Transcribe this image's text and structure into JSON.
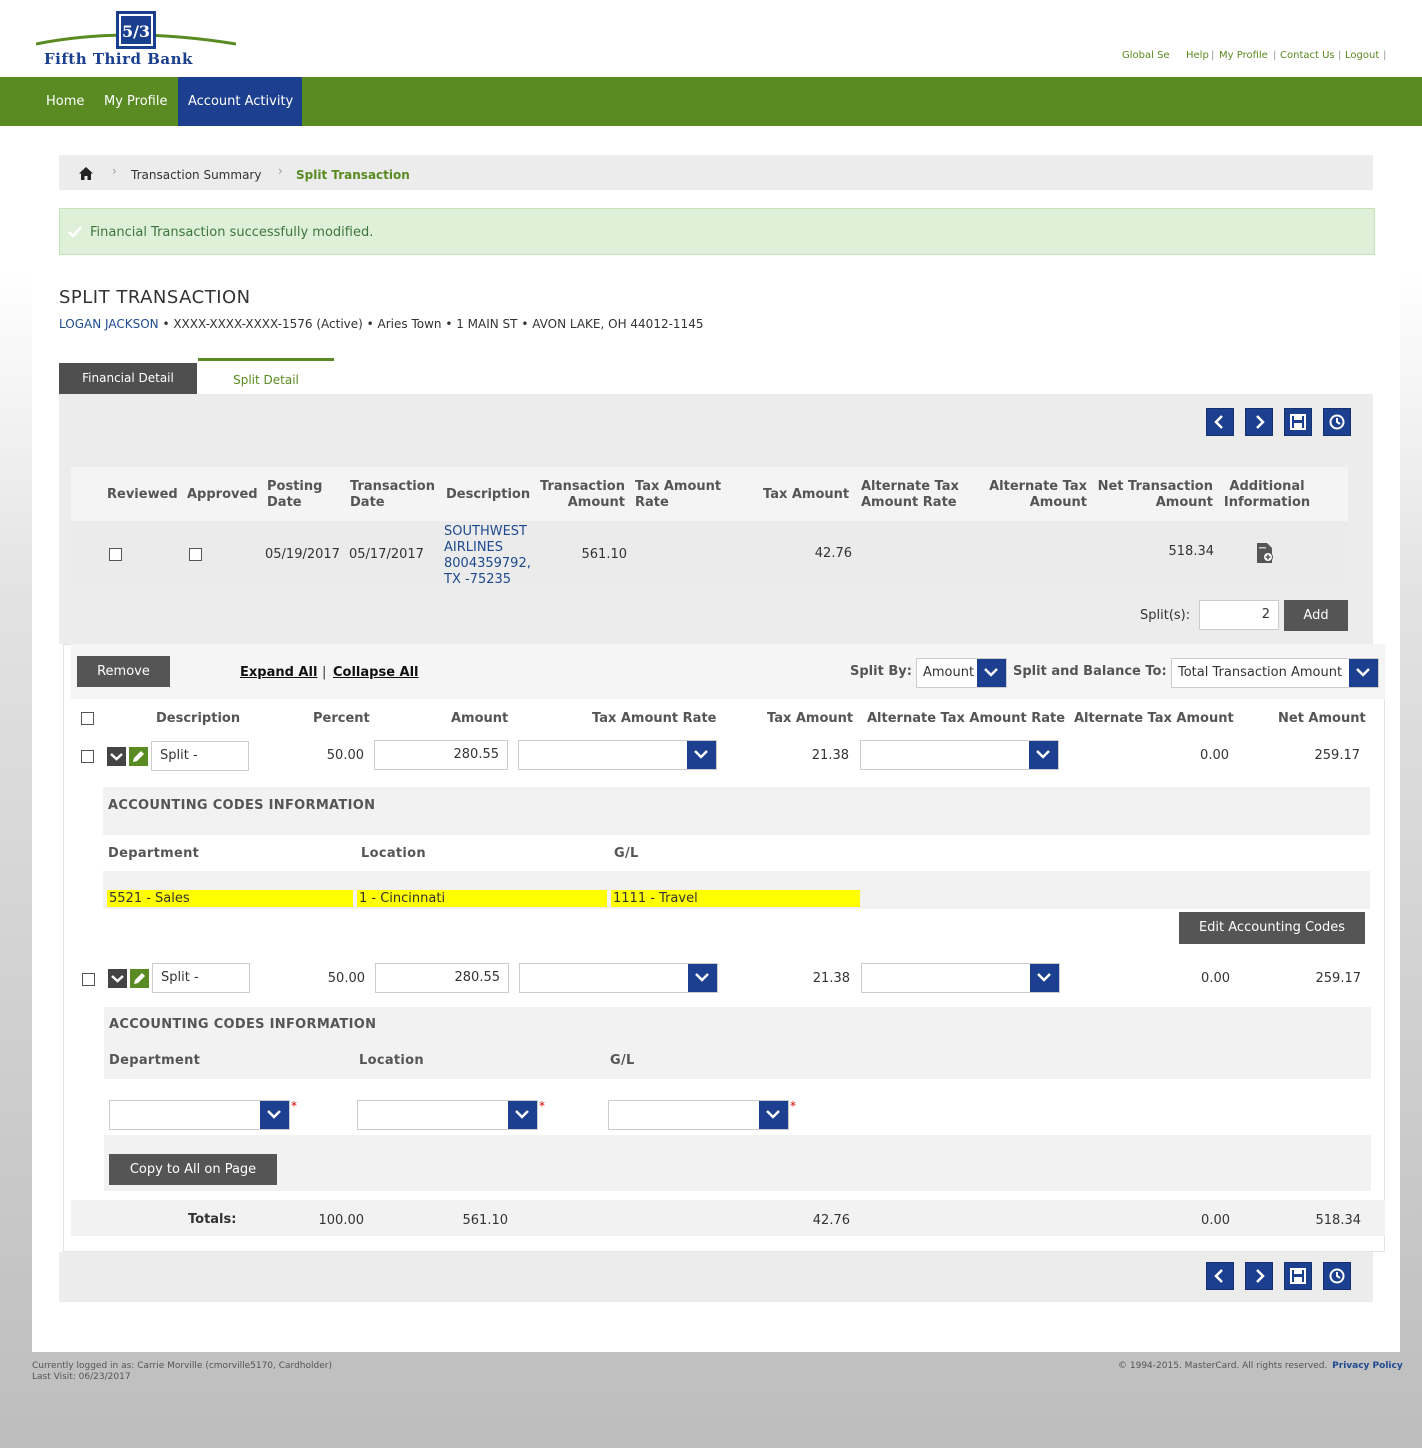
{
  "header": {
    "brand": "Fifth Third Bank",
    "links": [
      "Global Se",
      "Help",
      "My Profile",
      "Contact Us",
      "Logout"
    ],
    "nav": [
      "Home",
      "My Profile",
      "Account Activity"
    ]
  },
  "breadcrumb": [
    "Transaction Summary",
    "Split Transaction"
  ],
  "alert": "Financial Transaction successfully modified.",
  "page": {
    "title": "SPLIT TRANSACTION",
    "account_name": "LOGAN JACKSON",
    "account_info": " • XXXX-XXXX-XXXX-1576 (Active) • Aries Town • 1 MAIN ST • AVON LAKE, OH 44012-1145"
  },
  "tabs": [
    "Financial Detail",
    "Split Detail"
  ],
  "transaction": {
    "headers": {
      "reviewed": "Reviewed",
      "approved": "Approved",
      "posting_date": "Posting\nDate",
      "transaction_date": "Transaction\nDate",
      "description": "Description",
      "transaction_amount": "Transaction\nAmount",
      "tax_rate": "Tax Amount\nRate",
      "tax_amount": "Tax Amount",
      "alt_tax_rate": "Alternate Tax\nAmount Rate",
      "alt_tax_amount": "Alternate Tax\nAmount",
      "net_amount": "Net Transaction\nAmount",
      "additional_info": "Additional\nInformation"
    },
    "row": {
      "posting_date": "05/19/2017",
      "transaction_date": "05/17/2017",
      "description": "SOUTHWEST\nAIRLINES\n8004359792,\nTX -75235",
      "transaction_amount": "561.10",
      "tax_amount": "42.76",
      "net_amount": "518.34"
    }
  },
  "splits_control": {
    "label": "Split(s):",
    "value": "2",
    "add_label": "Add"
  },
  "split_toolbar": {
    "remove_label": "Remove",
    "expand_all": "Expand All",
    "separator": "|",
    "collapse_all": "Collapse All",
    "split_by_label": "Split By:",
    "split_by_value": "Amount",
    "balance_label": "Split and Balance To:",
    "balance_value": "Total Transaction Amount"
  },
  "split_headers": {
    "description": "Description",
    "percent": "Percent",
    "amount": "Amount",
    "tax_rate": "Tax Amount Rate",
    "tax_amount": "Tax Amount",
    "alt_tax_rate": "Alternate Tax Amount Rate",
    "alt_tax_amount": "Alternate Tax Amount",
    "net_amount": "Net Amount"
  },
  "splits": [
    {
      "description": "Split -",
      "percent": "50.00",
      "amount": "280.55",
      "tax_amount": "21.38",
      "alt_tax_amount": "0.00",
      "net_amount": "259.17",
      "acct_title": "ACCOUNTING CODES INFORMATION",
      "department_label": "Department",
      "location_label": "Location",
      "gl_label": "G/L",
      "department": "5521 - Sales",
      "location": "1 - Cincinnati",
      "gl": "1111 - Travel",
      "edit_label": "Edit Accounting Codes"
    },
    {
      "description": "Split -",
      "percent": "50.00",
      "amount": "280.55",
      "tax_amount": "21.38",
      "alt_tax_amount": "0.00",
      "net_amount": "259.17",
      "acct_title": "ACCOUNTING CODES INFORMATION",
      "department_label": "Department",
      "location_label": "Location",
      "gl_label": "G/L",
      "copy_label": "Copy to All on Page"
    }
  ],
  "totals": {
    "label": "Totals:",
    "percent": "100.00",
    "amount": "561.10",
    "tax_amount": "42.76",
    "alt_tax_amount": "0.00",
    "net_amount": "518.34"
  },
  "footer": {
    "logged_in": "Currently logged in as: Carrie Morville (cmorville5170, Cardholder)",
    "last_visit": "Last Visit: 06/23/2017",
    "copyright": "© 1994-2015. MasterCard. All rights reserved.",
    "privacy": "Privacy Policy"
  },
  "colors": {
    "brand_green": "#5a8a22",
    "brand_blue": "#1d3f8f",
    "highlight": "#ffff00"
  },
  "icons": [
    "home-icon",
    "chevron-left-icon",
    "chevron-right-icon",
    "save-icon",
    "history-icon",
    "document-add-icon",
    "expand-icon",
    "edit-pencil-icon",
    "checkmark-icon",
    "chevron-down-icon"
  ]
}
